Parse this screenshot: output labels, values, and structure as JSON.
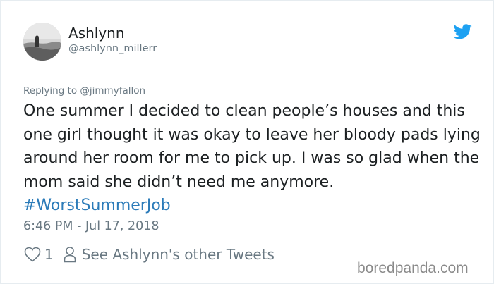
{
  "author": {
    "name": "Ashlynn",
    "handle": "@ashlynn_millerr"
  },
  "reply": {
    "prefix": "Replying to ",
    "mention": "@jimmyfallon"
  },
  "tweet": {
    "text": "One summer I decided to clean people’s houses and this one girl thought it was okay to leave her bloody pads lying around her room for me to pick up. I was so glad when the mom said she didn’t need me anymore. ",
    "hashtag": "#WorstSummerJob",
    "timestamp": "6:46 PM - Jul 17, 2018"
  },
  "actions": {
    "like_count": "1",
    "other_tweets_label": "See Ashlynn's other Tweets"
  },
  "watermark": "boredpanda.com",
  "colors": {
    "text": "#1c2022",
    "muted": "#697882",
    "link": "#2b7bb9",
    "twitter_blue": "#1da1f2"
  },
  "icons": [
    "avatar",
    "twitter-bird-icon",
    "heart-icon",
    "person-icon"
  ]
}
